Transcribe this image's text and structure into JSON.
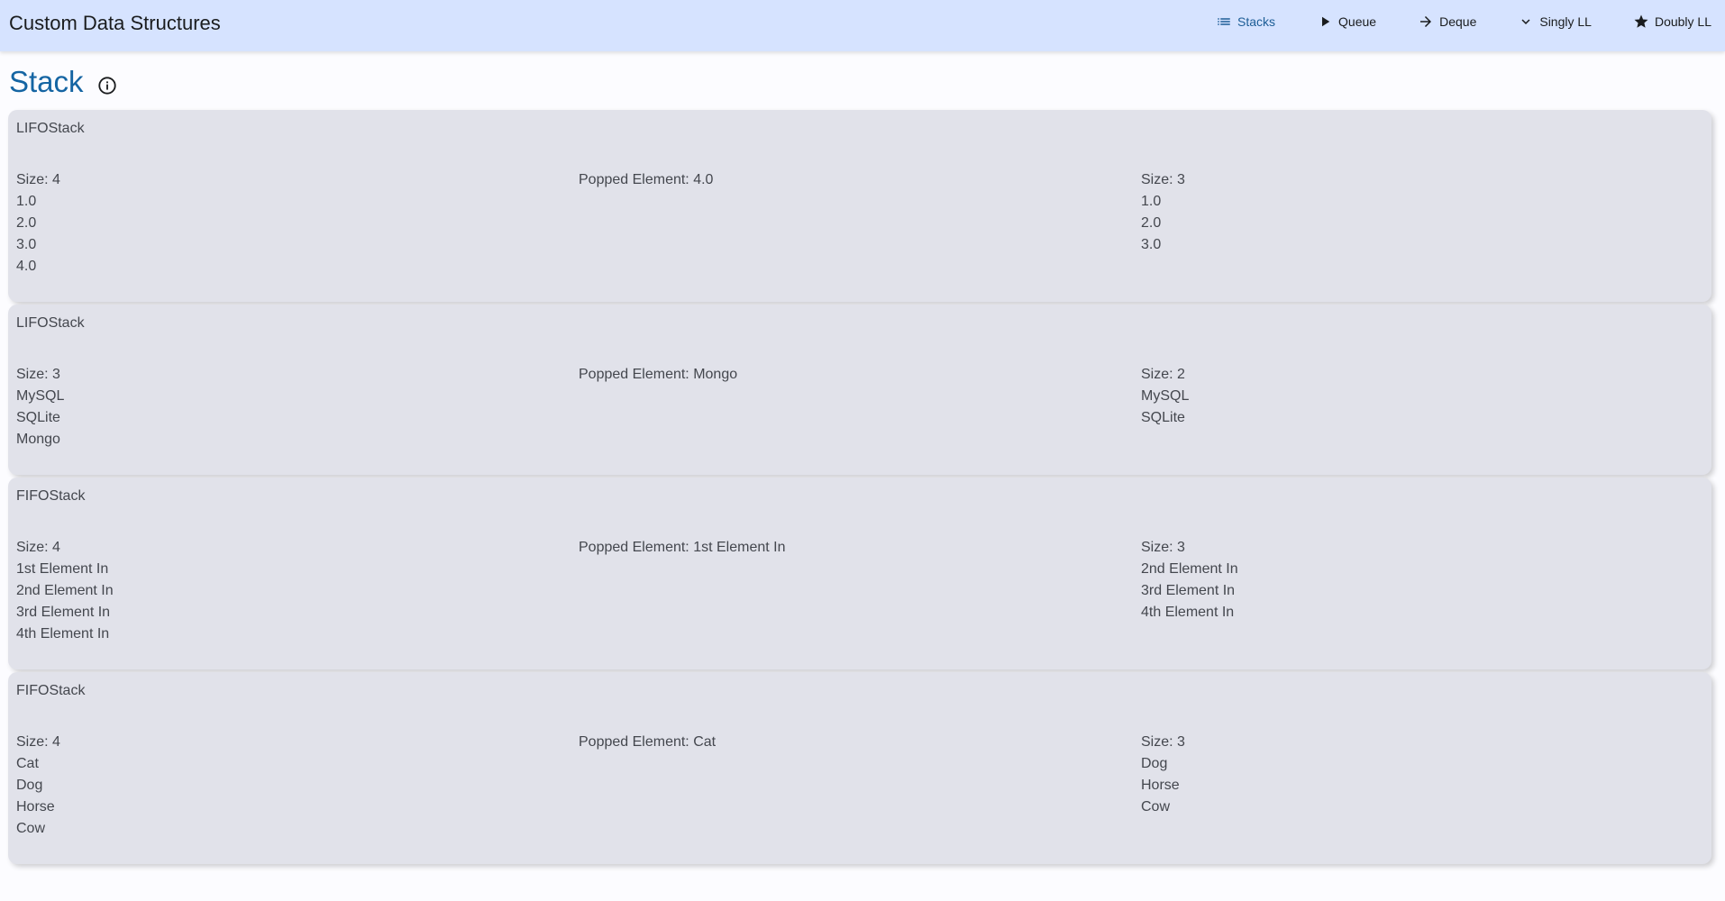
{
  "app": {
    "title": "Custom Data Structures"
  },
  "nav": [
    {
      "label": "Stacks",
      "icon": "list-icon",
      "active": true
    },
    {
      "label": "Queue",
      "icon": "play-icon",
      "active": false
    },
    {
      "label": "Deque",
      "icon": "arrow-right-icon",
      "active": false
    },
    {
      "label": "Singly LL",
      "icon": "chevron-down-icon",
      "active": false
    },
    {
      "label": "Doubly LL",
      "icon": "star-icon",
      "active": false
    }
  ],
  "page": {
    "title": "Stack",
    "info_icon": "info-icon"
  },
  "cards": [
    {
      "title": "LIFOStack",
      "before": {
        "size_label": "Size: 4",
        "items": [
          "1.0",
          "2.0",
          "3.0",
          "4.0"
        ]
      },
      "popped_label": "Popped Element: 4.0",
      "after": {
        "size_label": "Size: 3",
        "items": [
          "1.0",
          "2.0",
          "3.0"
        ]
      }
    },
    {
      "title": "LIFOStack",
      "before": {
        "size_label": "Size: 3",
        "items": [
          "MySQL",
          "SQLite",
          "Mongo"
        ]
      },
      "popped_label": "Popped Element: Mongo",
      "after": {
        "size_label": "Size: 2",
        "items": [
          "MySQL",
          "SQLite"
        ]
      }
    },
    {
      "title": "FIFOStack",
      "before": {
        "size_label": "Size: 4",
        "items": [
          "1st Element In",
          "2nd Element In",
          "3rd Element In",
          "4th Element In"
        ]
      },
      "popped_label": "Popped Element: 1st Element In",
      "after": {
        "size_label": "Size: 3",
        "items": [
          "2nd Element In",
          "3rd Element In",
          "4th Element In"
        ]
      }
    },
    {
      "title": "FIFOStack",
      "before": {
        "size_label": "Size: 4",
        "items": [
          "Cat",
          "Dog",
          "Horse",
          "Cow"
        ]
      },
      "popped_label": "Popped Element: Cat",
      "after": {
        "size_label": "Size: 3",
        "items": [
          "Dog",
          "Horse",
          "Cow"
        ]
      }
    }
  ],
  "colors": {
    "topbar_bg": "#d6e3ff",
    "accent": "#1565a3",
    "card_bg": "#e1e2ea"
  }
}
